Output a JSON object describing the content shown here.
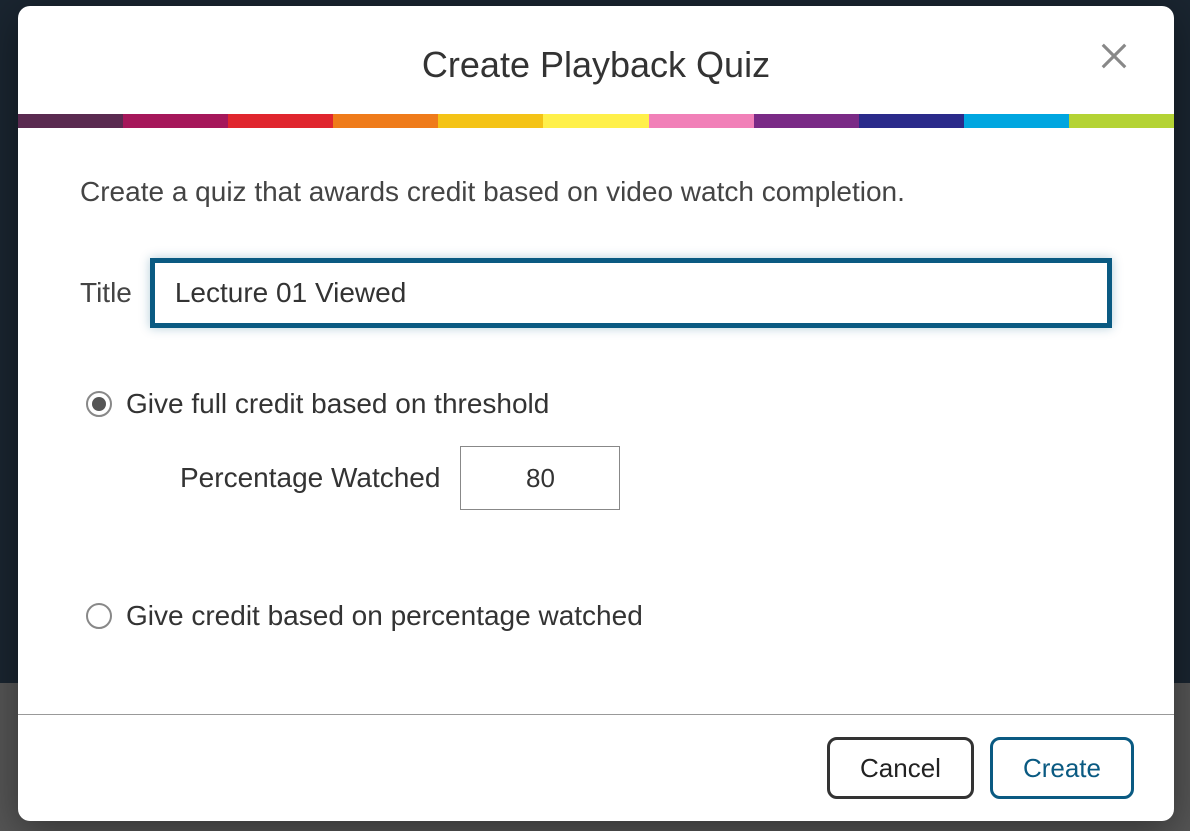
{
  "modal": {
    "title": "Create Playback Quiz",
    "description": "Create a quiz that awards credit based on video watch completion.",
    "title_label": "Title",
    "title_value": "Lecture 01 Viewed",
    "option_threshold": {
      "label": "Give full credit based on threshold",
      "selected": true,
      "percentage_label": "Percentage Watched",
      "percentage_value": "80"
    },
    "option_percentage": {
      "label": "Give credit based on percentage watched",
      "selected": false
    },
    "buttons": {
      "cancel": "Cancel",
      "create": "Create"
    }
  },
  "colors": {
    "bar": [
      "#5a2a50",
      "#a5175a",
      "#e0262e",
      "#ef7b1a",
      "#f4c316",
      "#fff04a",
      "#f180b8",
      "#7a2a86",
      "#2a2a8a",
      "#00a6e0",
      "#b4d334"
    ]
  }
}
